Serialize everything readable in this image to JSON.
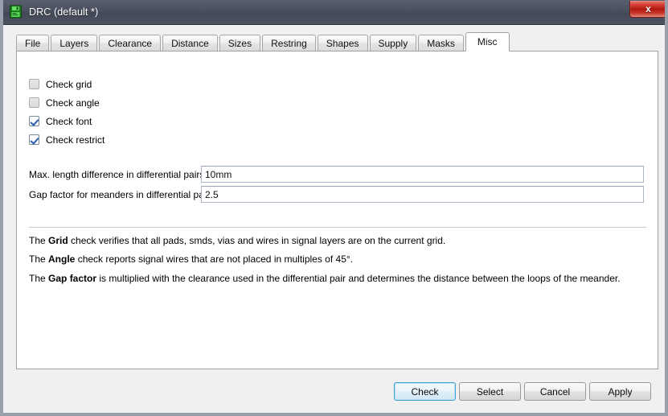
{
  "window": {
    "title": "DRC (default *)",
    "icon": "save-floppy-icon",
    "close_label": "x",
    "titlebar_color": "#4b5060",
    "accent_color": "#3c9fd4"
  },
  "tabs": [
    {
      "label": "File",
      "selected": false
    },
    {
      "label": "Layers",
      "selected": false
    },
    {
      "label": "Clearance",
      "selected": false
    },
    {
      "label": "Distance",
      "selected": false
    },
    {
      "label": "Sizes",
      "selected": false
    },
    {
      "label": "Restring",
      "selected": false
    },
    {
      "label": "Shapes",
      "selected": false
    },
    {
      "label": "Supply",
      "selected": false
    },
    {
      "label": "Masks",
      "selected": false
    },
    {
      "label": "Misc",
      "selected": true
    }
  ],
  "checkboxes": [
    {
      "label": "Check grid",
      "checked": false
    },
    {
      "label": "Check angle",
      "checked": false
    },
    {
      "label": "Check font",
      "checked": true
    },
    {
      "label": "Check restrict",
      "checked": true
    }
  ],
  "fields": [
    {
      "label": "Max. length difference in differential pairs",
      "value": "10mm",
      "placeholder": ""
    },
    {
      "label": "Gap factor for meanders in differential pairs",
      "value": "2.5",
      "placeholder": ""
    }
  ],
  "descriptions": [
    {
      "prefix": "The ",
      "term": "Grid",
      "suffix": " check verifies that all pads, smds, vias and wires in signal layers are on the current grid."
    },
    {
      "prefix": "The ",
      "term": "Angle",
      "suffix": " check reports signal wires that are not placed in multiples of 45°."
    },
    {
      "prefix": "The ",
      "term": "Gap factor",
      "suffix": " is multiplied with the clearance used in the differential pair and determines the distance between the loops of the meander."
    }
  ],
  "buttons": [
    {
      "label": "Check",
      "focused": true
    },
    {
      "label": "Select",
      "focused": false
    },
    {
      "label": "Cancel",
      "focused": false
    },
    {
      "label": "Apply",
      "focused": false
    }
  ]
}
